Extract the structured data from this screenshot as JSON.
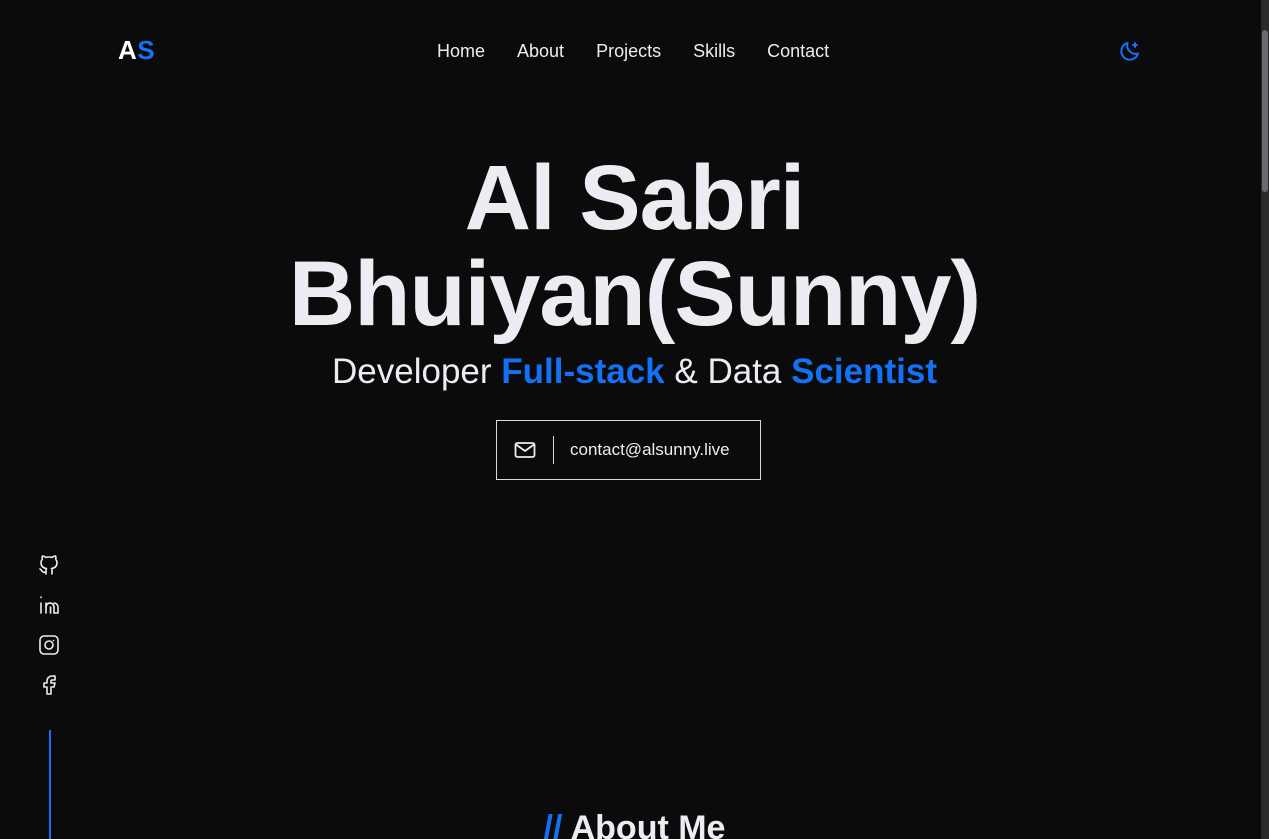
{
  "logo": {
    "part1": "A",
    "part2": "S"
  },
  "nav": {
    "items": [
      {
        "label": "Home"
      },
      {
        "label": "About"
      },
      {
        "label": "Projects"
      },
      {
        "label": "Skills"
      },
      {
        "label": "Contact"
      }
    ]
  },
  "theme_toggle": {
    "icon": "moon-star-icon"
  },
  "hero": {
    "name_line1": "Al Sabri",
    "name_line2": "Bhuiyan(Sunny)",
    "subtitle": {
      "part1": "Developer ",
      "accent1": "Full-stack",
      "part2": " & Data ",
      "accent2": "Scientist"
    },
    "contact_email": "contact@alsunny.live"
  },
  "social": {
    "icons": [
      "github-icon",
      "linkedin-icon",
      "instagram-icon",
      "facebook-icon"
    ]
  },
  "about": {
    "slashes": "//",
    "title": " About Me"
  },
  "colors": {
    "background": "#0b0b0c",
    "accent": "#1471f5",
    "text": "#ececf3"
  }
}
